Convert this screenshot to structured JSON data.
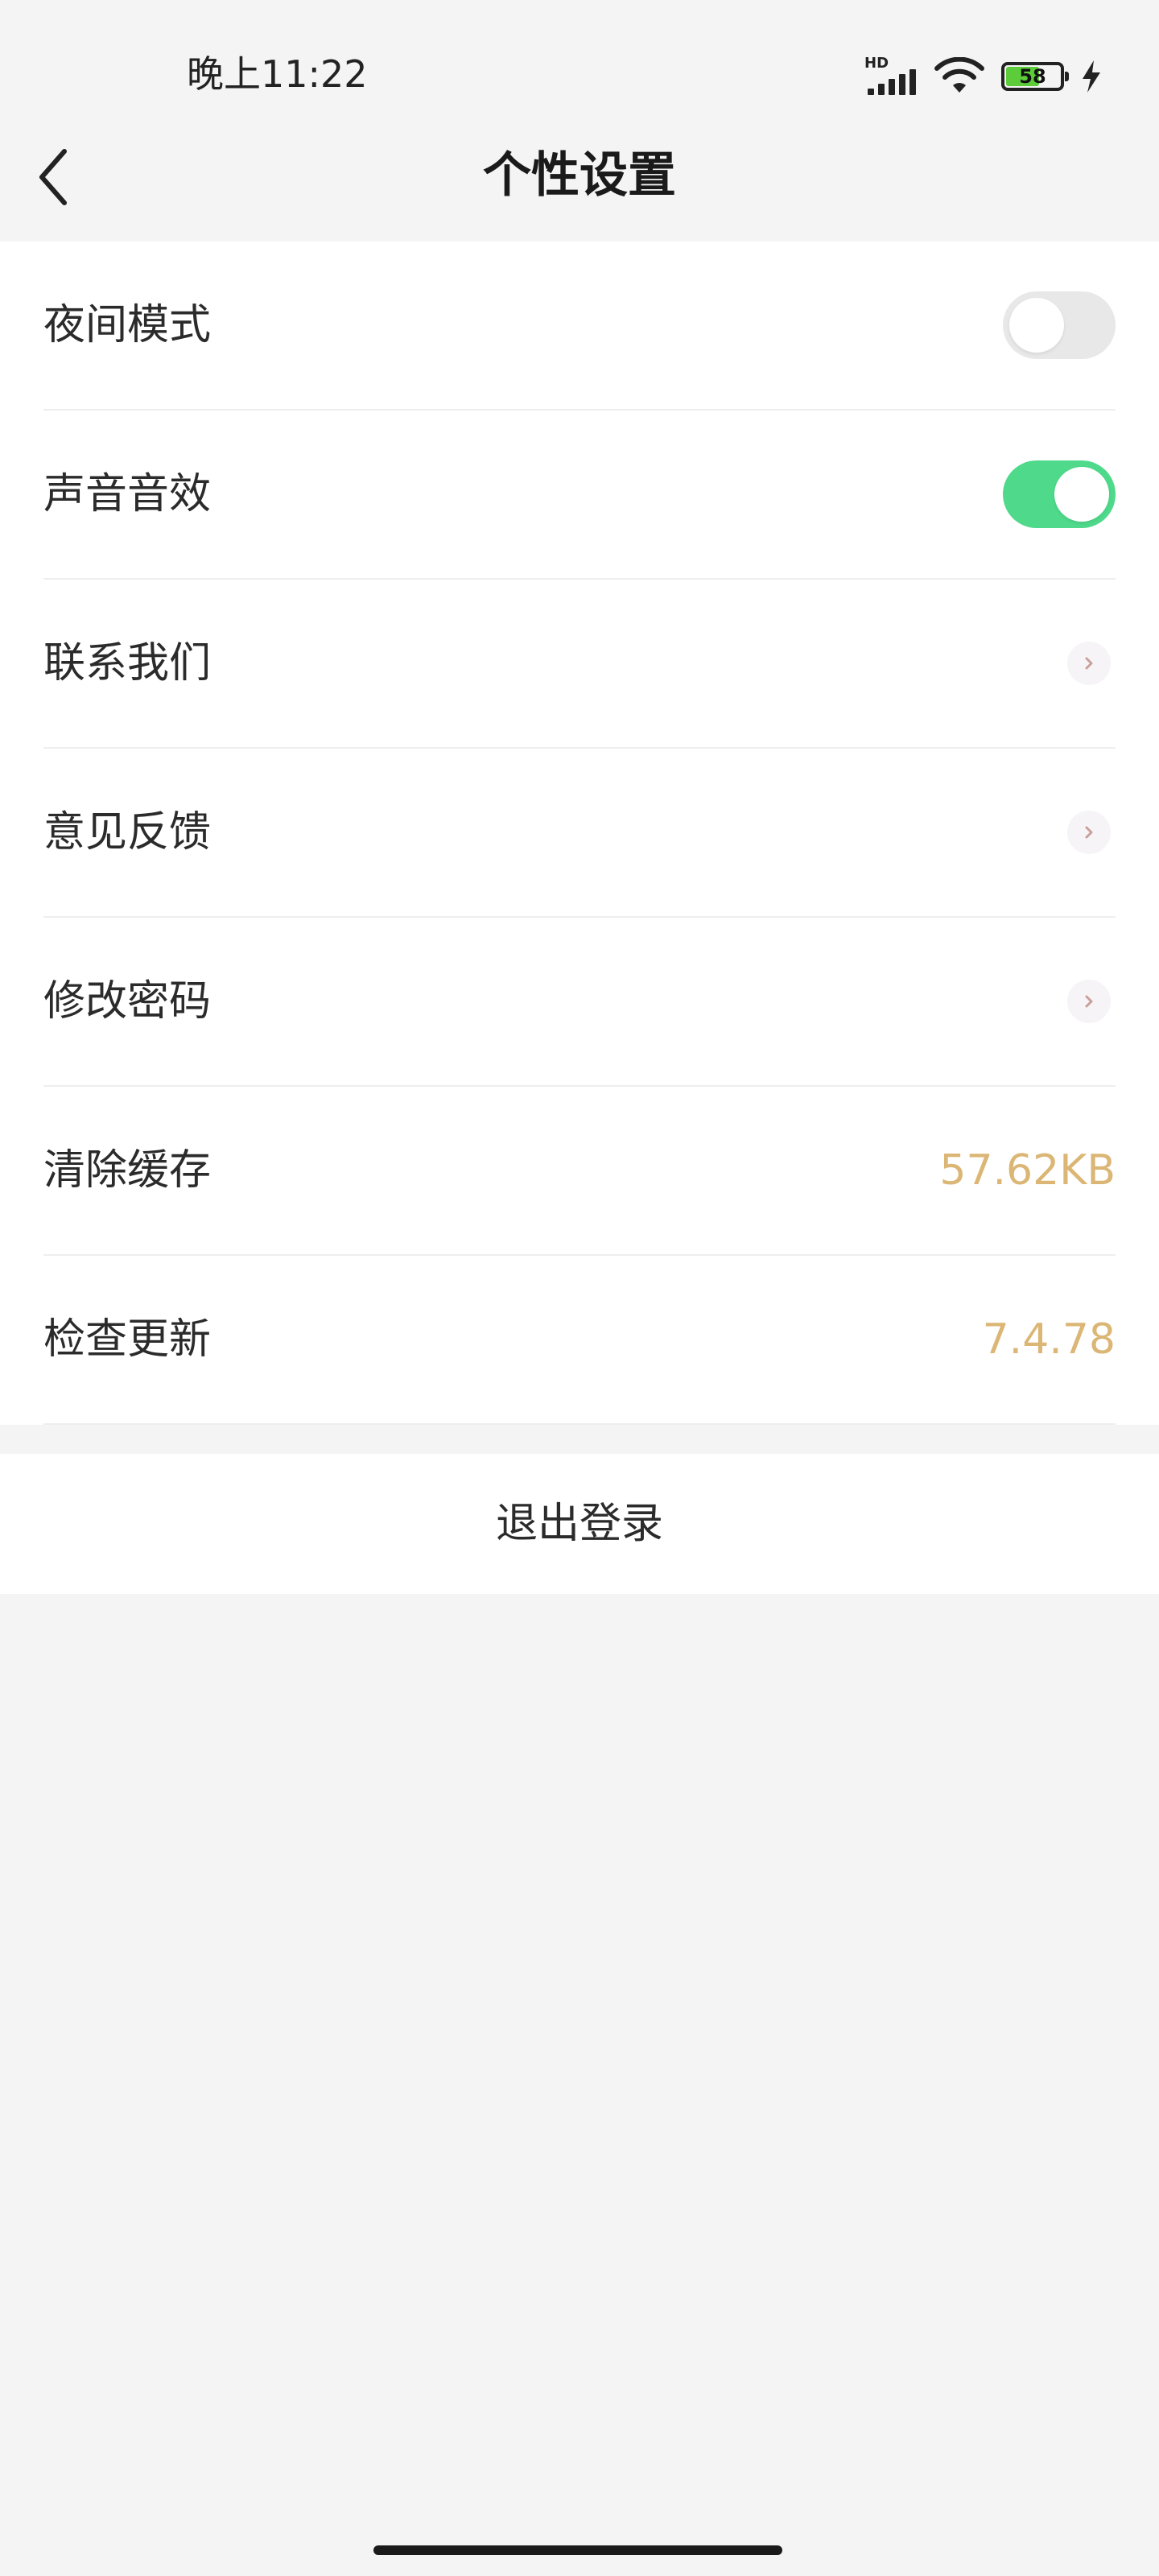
{
  "status_bar": {
    "time": "晚上11:22",
    "network_label": "HD",
    "battery_level": "58",
    "icons": [
      "signal-icon",
      "wifi-icon",
      "battery-icon",
      "charging-bolt-icon"
    ]
  },
  "nav": {
    "title": "个性设置",
    "back_icon": "chevron-left-icon"
  },
  "settings": {
    "night_mode": {
      "label": "夜间模式",
      "enabled": false
    },
    "sound_effects": {
      "label": "声音音效",
      "enabled": true
    },
    "contact_us": {
      "label": "联系我们",
      "icon": "chevron-right-icon"
    },
    "feedback": {
      "label": "意见反馈",
      "icon": "chevron-right-icon"
    },
    "change_password": {
      "label": "修改密码",
      "icon": "chevron-right-icon"
    },
    "clear_cache": {
      "label": "清除缓存",
      "value": "57.62KB"
    },
    "check_update": {
      "label": "检查更新",
      "value": "7.4.78"
    }
  },
  "logout": {
    "label": "退出登录"
  },
  "colors": {
    "toggle_on": "#4fd98b",
    "toggle_off": "#e8e8e8",
    "value_text": "#dbb675",
    "page_background": "#f4f4f4",
    "chevron": "#c9a09a"
  }
}
